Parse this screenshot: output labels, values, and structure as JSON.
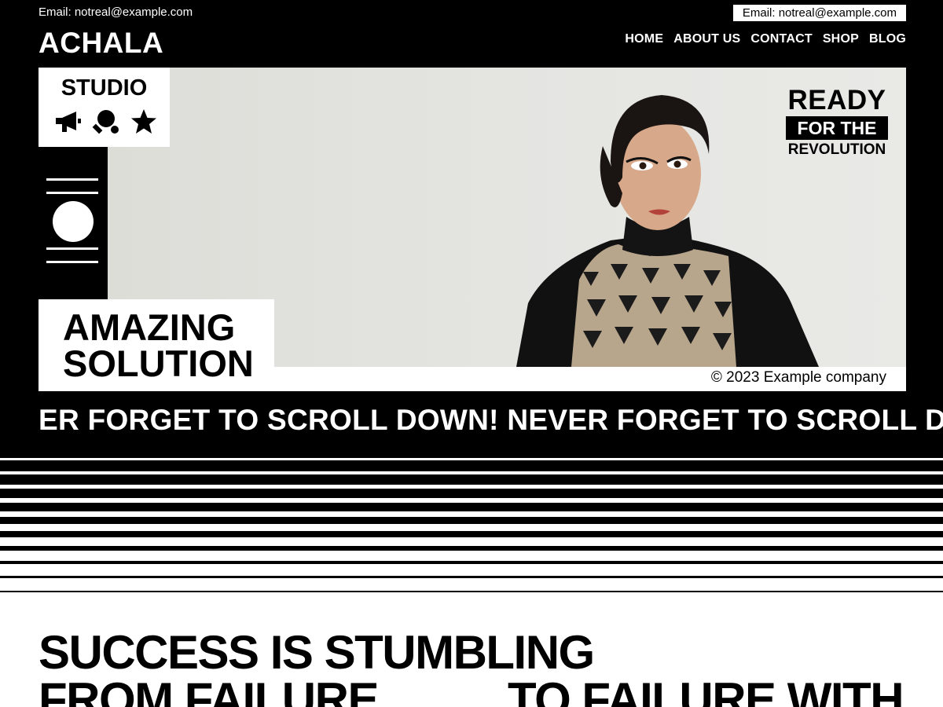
{
  "topbar": {
    "email_left": "Email: notreal@example.com",
    "email_right": "Email: notreal@example.com"
  },
  "header": {
    "logo": "ACHALA",
    "nav": [
      "HOME",
      "ABOUT US",
      "CONTACT",
      "SHOP",
      "BLOG"
    ]
  },
  "hero": {
    "studio_label": "STUDIO",
    "studio_icons": [
      "megaphone-icon",
      "ping-pong-icon",
      "star-icon"
    ],
    "ready": "READY",
    "for_the": "FOR THE",
    "revolution": "REVOLUTION",
    "amazing_line1": "AMAZING",
    "amazing_line2": "SOLUTION",
    "copyright": "© 2023 Example company",
    "photo": "portrait-photo"
  },
  "marquee": {
    "text": "ER FORGET TO SCROLL DOWN! NEVER FORGET TO SCROLL DO"
  },
  "lower": {
    "heading_line1": "SUCCESS IS STUMBLING",
    "heading_line2a": "FROM FAILURE",
    "heading_line2b": "TO FAILURE WITH"
  },
  "colors": {
    "background": "#000000",
    "foreground": "#ffffff"
  }
}
